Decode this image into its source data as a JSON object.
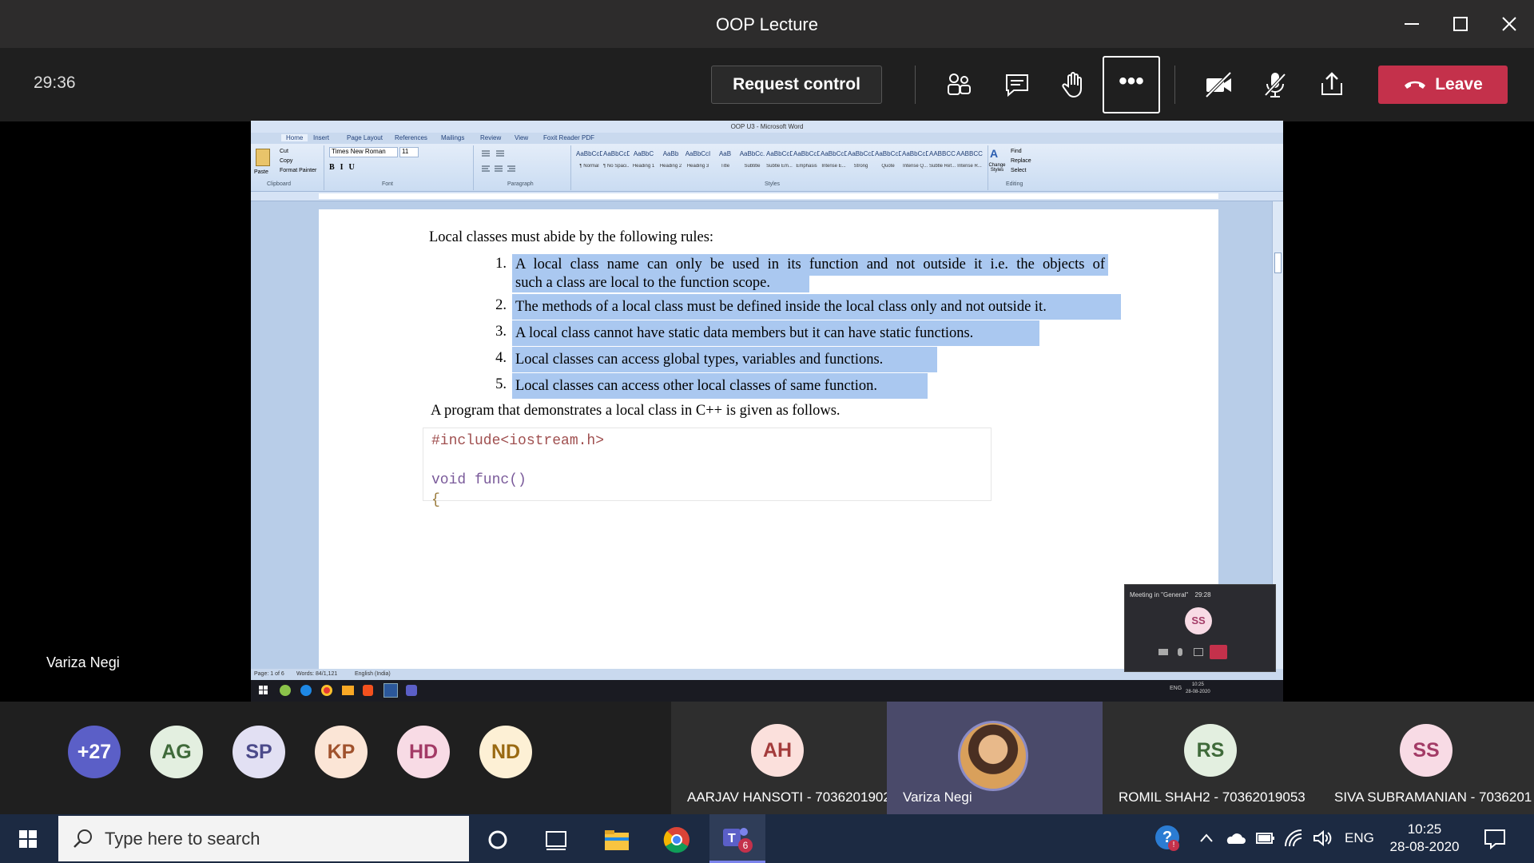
{
  "window": {
    "title": "OOP Lecture"
  },
  "toolbar": {
    "timer": "29:36",
    "request_control": "Request control",
    "leave_label": "Leave"
  },
  "sharer": {
    "name": "Variza Negi"
  },
  "word": {
    "title": "OOP U3 - Microsoft Word",
    "tabs": [
      "Home",
      "Insert",
      "Page Layout",
      "References",
      "Mailings",
      "Review",
      "View",
      "Foxit Reader PDF"
    ],
    "font_name": "Times New Roman",
    "font_size": "11",
    "styles": [
      {
        "preview": "AaBbCcDc",
        "name": "¶ Normal"
      },
      {
        "preview": "AaBbCcDc",
        "name": "¶ No Spaci..."
      },
      {
        "preview": "AaBbC",
        "name": "Heading 1"
      },
      {
        "preview": "AaBb",
        "name": "Heading 2"
      },
      {
        "preview": "AaBbCcI",
        "name": "Heading 3"
      },
      {
        "preview": "AaB",
        "name": "Title"
      },
      {
        "preview": "AaBbCc.",
        "name": "Subtitle"
      },
      {
        "preview": "AaBbCcDi",
        "name": "Subtle Em..."
      },
      {
        "preview": "AaBbCcDi",
        "name": "Emphasis"
      },
      {
        "preview": "AaBbCcDi",
        "name": "Intense E..."
      },
      {
        "preview": "AaBbCcDc",
        "name": "Strong"
      },
      {
        "preview": "AaBbCcDi",
        "name": "Quote"
      },
      {
        "preview": "AaBbCcDi",
        "name": "Intense Q..."
      },
      {
        "preview": "AABBCCDE",
        "name": "Subtle Ref..."
      },
      {
        "preview": "AABBCCDE",
        "name": "Intense R..."
      }
    ],
    "groups": [
      "Clipboard",
      "Font",
      "Paragraph",
      "Styles",
      "Editing"
    ],
    "clipboard": [
      "Paste",
      "Cut",
      "Copy",
      "Format Painter"
    ],
    "editing": [
      "Find",
      "Replace",
      "Select"
    ],
    "change_styles": "Change Styles",
    "status": {
      "page": "Page: 1 of 6",
      "words": "Words: 84/1,121",
      "lang": "English (India)"
    },
    "doc": {
      "intro": "Local classes must abide by the following rules:",
      "rules": [
        {
          "num": "1.",
          "line1": "A local class name can only be used in its function and not outside it i.e. the objects of",
          "line2": "such a class are local to the function scope."
        },
        {
          "num": "2.",
          "line1": "The methods of a local class must be defined inside the local class only and not outside it."
        },
        {
          "num": "3.",
          "line1": "A local class cannot have static data members but it can have static functions."
        },
        {
          "num": "4.",
          "line1": "Local classes can access global types, variables and functions."
        },
        {
          "num": "5.",
          "line1": "Local classes can access other local classes of same function."
        }
      ],
      "program_intro": "A program that demonstrates a local class in C++ is given as follows.",
      "code": [
        "#include<iostream.h>",
        "void func()",
        "{"
      ]
    },
    "inner_clock": {
      "time": "10:25",
      "date": "28-08-2020"
    },
    "inner_lang": "ENG"
  },
  "mini_meeting": {
    "title": "Meeting in \"General\"",
    "time": "29:28",
    "initials": "SS"
  },
  "participants": [
    {
      "initials": "+27",
      "bg": "#5b5fc7",
      "fg": "#ffffff"
    },
    {
      "initials": "AG",
      "bg": "#e3efe0",
      "fg": "#3f6a3a"
    },
    {
      "initials": "SP",
      "bg": "#e2e0f3",
      "fg": "#4b4a8a"
    },
    {
      "initials": "KP",
      "bg": "#fbe5d6",
      "fg": "#a0522d"
    },
    {
      "initials": "HD",
      "bg": "#f8dbe5",
      "fg": "#a33b66"
    },
    {
      "initials": "ND",
      "bg": "#fdf0d5",
      "fg": "#9a6a12"
    }
  ],
  "named_participants": [
    {
      "initials": "AH",
      "name": "AARJAV HANSOTI - 7036201902",
      "bg": "#fbe0dc",
      "fg": "#a33b3b"
    },
    {
      "initials": "RS",
      "name": "ROMIL SHAH2 - 70362019053",
      "bg": "#e3efe0",
      "fg": "#3f6a3a"
    },
    {
      "initials": "SS",
      "name": "SIVA SUBRAMANIAN - 7036201",
      "bg": "#f8dbe5",
      "fg": "#a33b66"
    }
  ],
  "presenter_tile": {
    "name": "Variza Negi"
  },
  "taskbar": {
    "search_placeholder": "Type here to search",
    "lang": "ENG",
    "time": "10:25",
    "date": "28-08-2020",
    "teams_badge": "6",
    "help_badge": "!"
  }
}
